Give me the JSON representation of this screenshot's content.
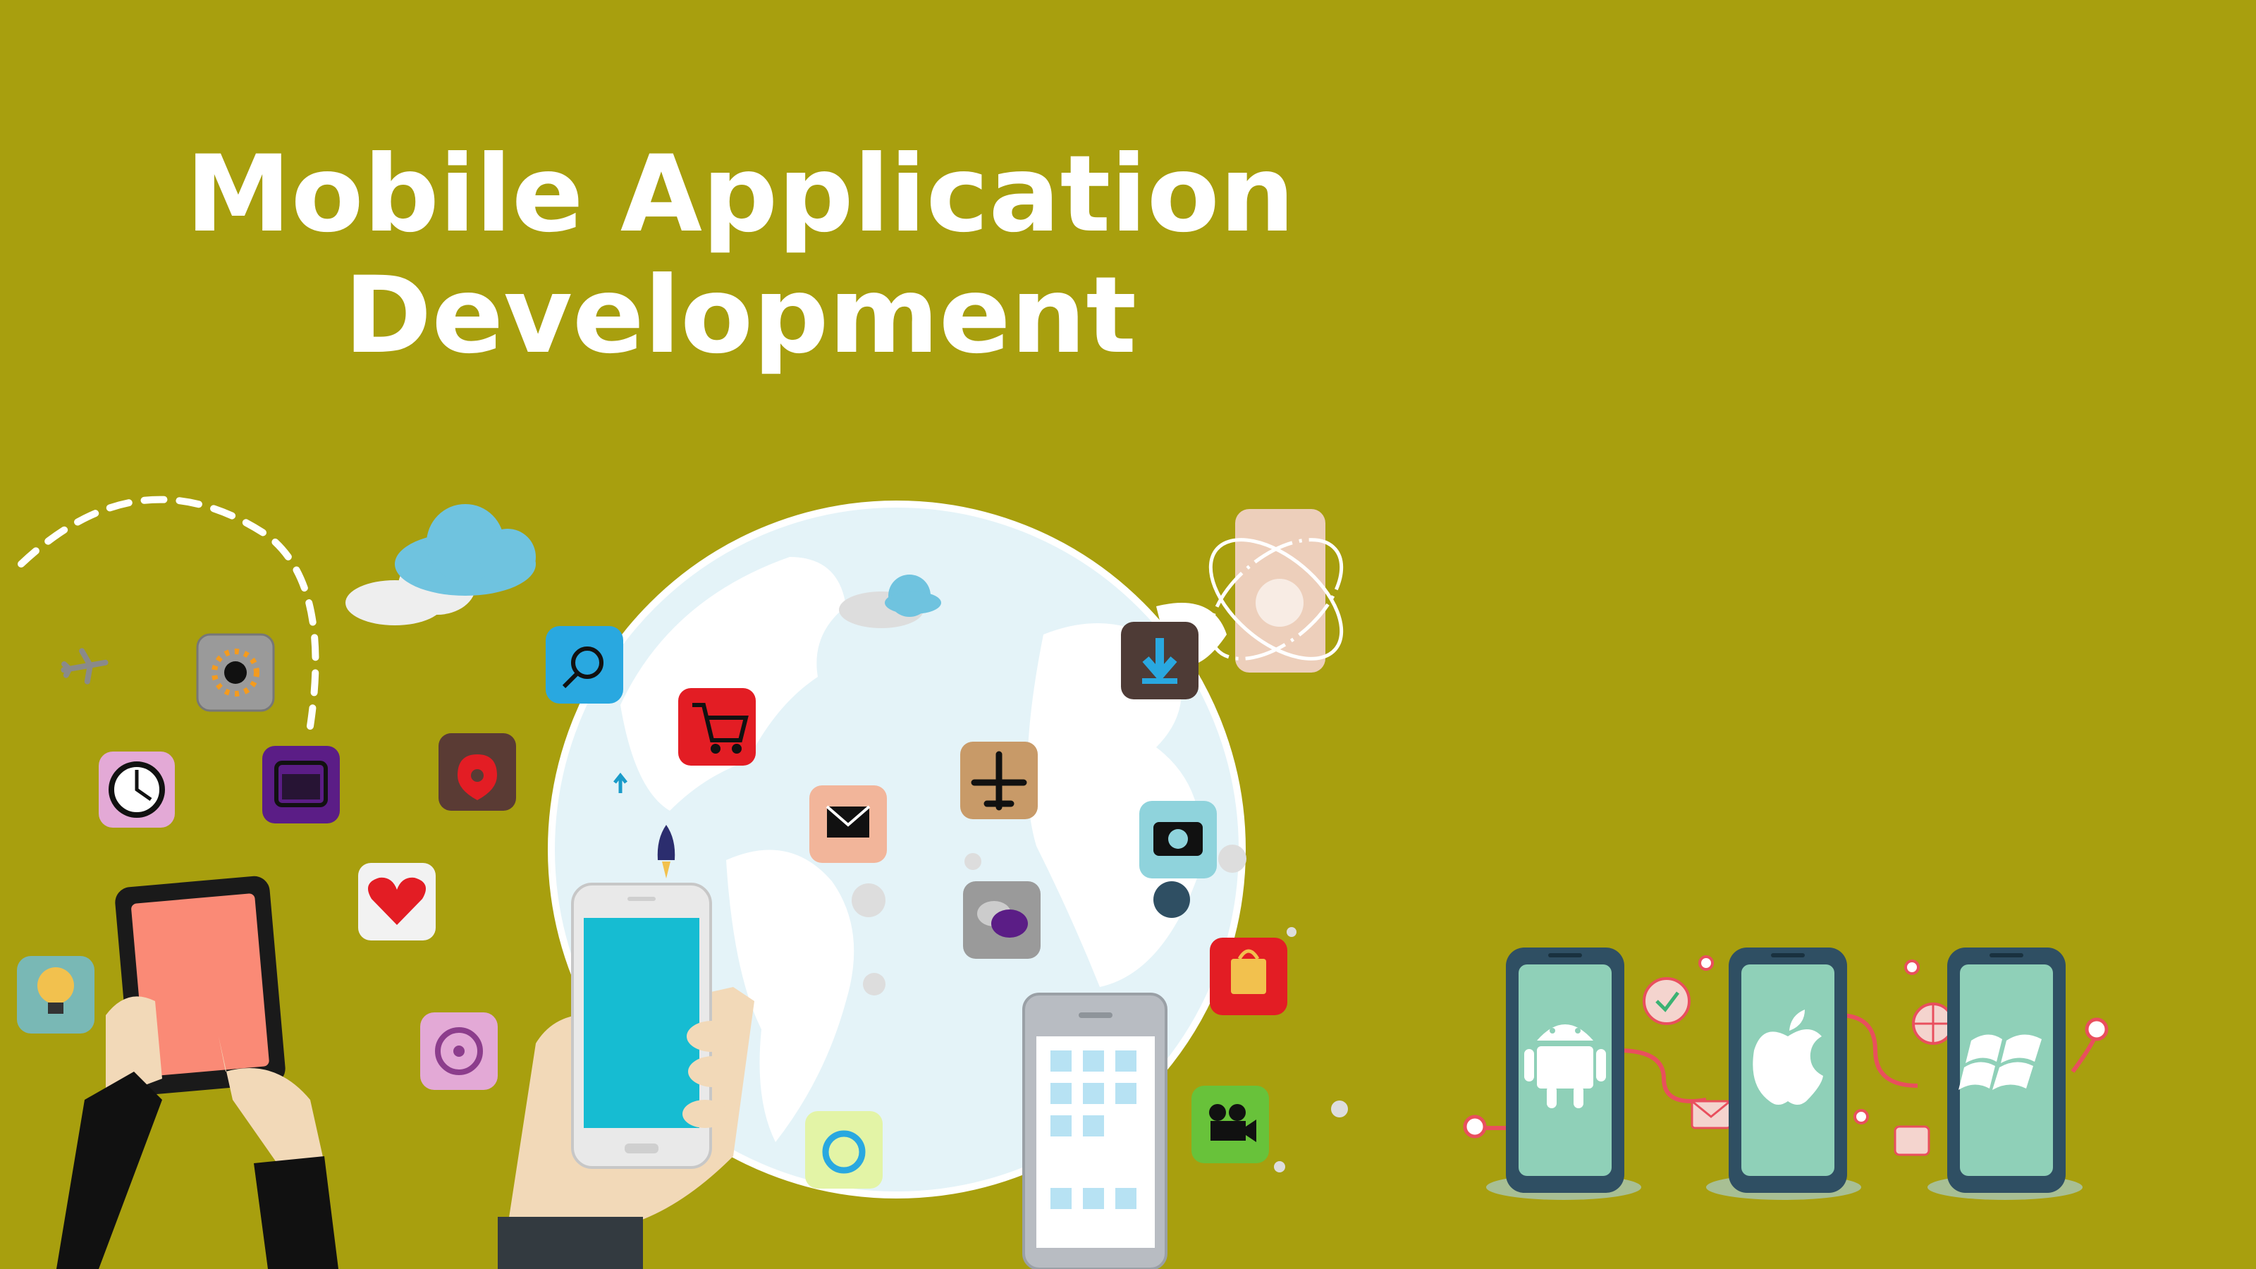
{
  "title": {
    "line1": "Mobile Application",
    "line2": "Development"
  },
  "colors": {
    "background": "#a89f0e",
    "globe": "#e4f3f8",
    "continents": "#ffffff",
    "phone_screen": "#16bcd2",
    "tablet_screen": "#fa8a76",
    "platform_phone_body": "#2f4f63",
    "platform_phone_screen": "#8fd0b8",
    "connector_lines": "#e94f5d"
  },
  "icons": [
    "settings-icon",
    "alarm-clock-icon",
    "calendar-icon",
    "location-pin-icon",
    "heart-icon",
    "lightbulb-icon",
    "music-disc-icon",
    "search-icon",
    "shopping-cart-icon",
    "email-icon",
    "airplane-icon",
    "chat-icon",
    "download-icon",
    "camera-icon",
    "shopping-bag-icon",
    "video-camera-icon",
    "power-icon",
    "android-logo-icon",
    "apple-logo-icon",
    "windows-logo-icon"
  ]
}
